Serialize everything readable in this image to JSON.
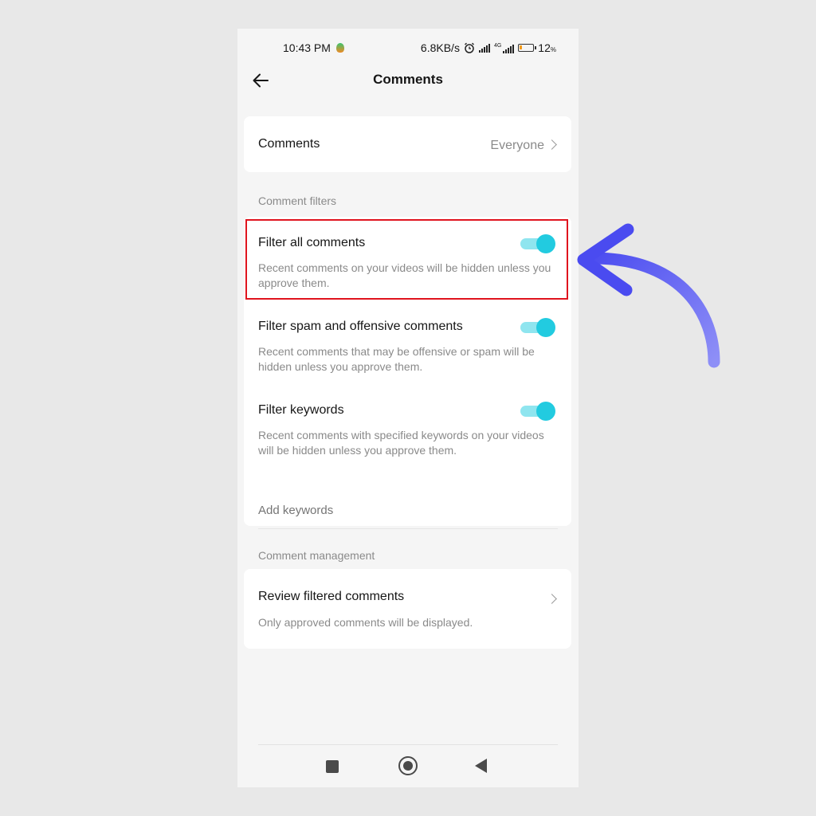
{
  "status_bar": {
    "time": "10:43 PM",
    "network_speed": "6.8KB/s",
    "network_type": "4G",
    "battery": "12",
    "battery_unit": "%",
    "icons": [
      "app-notification-icon",
      "alarm-icon",
      "signal-icon",
      "signal-4g-icon",
      "battery-icon"
    ]
  },
  "header": {
    "title": "Comments",
    "back_icon": "back-arrow-icon"
  },
  "comments_setting": {
    "label": "Comments",
    "value": "Everyone"
  },
  "filters": {
    "section_label": "Comment filters",
    "items": [
      {
        "title": "Filter all comments",
        "description": "Recent comments on your videos will be hidden unless you approve them.",
        "enabled": true
      },
      {
        "title": "Filter spam and offensive comments",
        "description": "Recent comments that may be offensive or spam will be hidden unless you approve them.",
        "enabled": true
      },
      {
        "title": "Filter keywords",
        "description": "Recent comments with specified keywords on your videos will be hidden unless you approve them.",
        "enabled": true
      }
    ],
    "keywords_placeholder": "Add keywords"
  },
  "management": {
    "section_label": "Comment management",
    "review_title": "Review filtered comments",
    "review_description": "Only approved comments will be displayed."
  },
  "nav_bar": {
    "icons": [
      "recents-square-icon",
      "home-circle-icon",
      "back-triangle-icon"
    ]
  },
  "annotation": {
    "highlight_color": "#e0141e",
    "arrow_color": "#5b5cf0"
  },
  "colors": {
    "toggle_knob": "#22cbe0",
    "toggle_track": "#8fe5ef"
  }
}
